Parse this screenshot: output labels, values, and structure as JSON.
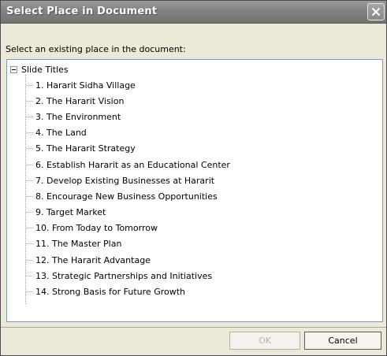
{
  "window": {
    "title": "Select Place in Document",
    "close_icon": "close-icon"
  },
  "prompt": "Select an existing place in the document:",
  "tree": {
    "root_label": "Slide Titles",
    "root_expander": "collapse-icon",
    "items": [
      "1. Hararit Sidha Village",
      "2. The Hararit Vision",
      "3. The Environment",
      "4. The Land",
      "5. The Hararit Strategy",
      "6. Establish Hararit as an Educational Center",
      "7. Develop Existing Businesses at Hararit",
      "8. Encourage New Business Opportunities",
      "9. Target Market",
      "10. From Today to Tomorrow",
      "11. The Master Plan",
      "12. The Hararit Advantage",
      "13. Strategic Partnerships and Initiatives",
      "14. Strong Basis for Future Growth"
    ]
  },
  "buttons": {
    "ok_label": "OK",
    "ok_enabled": false,
    "cancel_label": "Cancel"
  }
}
